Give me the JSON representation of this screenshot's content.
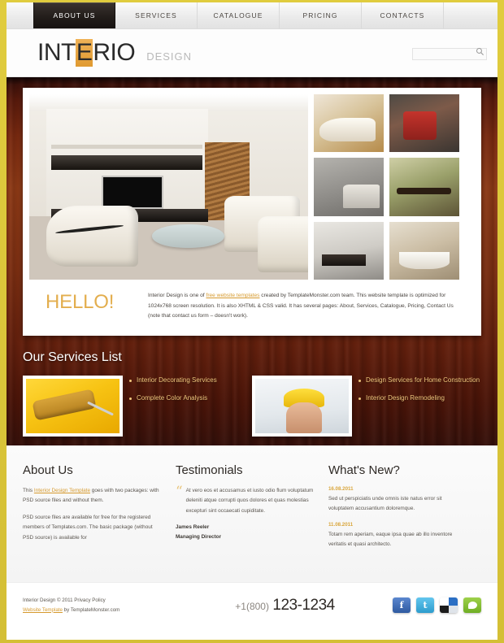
{
  "nav": {
    "items": [
      {
        "label": "ABOUT US",
        "active": true
      },
      {
        "label": "SERVICES",
        "active": false
      },
      {
        "label": "CATALOGUE",
        "active": false
      },
      {
        "label": "PRICING",
        "active": false
      },
      {
        "label": "CONTACTS",
        "active": false
      }
    ]
  },
  "brand": {
    "part1": "INT",
    "highlight": "E",
    "part2": "RIO",
    "tagline": "DESIGN"
  },
  "search": {
    "value": "",
    "placeholder": "",
    "icon": "search-icon"
  },
  "hero": {
    "main_image_alt": "modern living room with white leather furniture",
    "thumbs": [
      {
        "alt": "white lounge chair"
      },
      {
        "alt": "red chair and table"
      },
      {
        "alt": "grey bedroom"
      },
      {
        "alt": "antique table and chairs"
      },
      {
        "alt": "dark coffee table"
      },
      {
        "alt": "bathroom with tub"
      }
    ],
    "hello": "HELLO!",
    "intro_before": "Interior Design is one of ",
    "intro_link": "free website templates",
    "intro_after": " created by TemplateMonster.com team. This website template is optimized for 1024x768 screen resolution. It is also XHTML & CSS valid. It has several pages: About, Services, Catalogue, Pricing, Contact Us (note that contact us form – doesn't work)."
  },
  "services": {
    "title": "Our Services List",
    "groups": [
      {
        "image_alt": "paint roller on yellow background",
        "items": [
          "Interior Decorating Services",
          "Complete Color Analysis"
        ]
      },
      {
        "image_alt": "smiling worker in yellow hard hat",
        "items": [
          "Design Services for Home Construction",
          "Interior Design Remodeling"
        ]
      }
    ]
  },
  "about": {
    "title": "About Us",
    "p1_before": "This ",
    "p1_link": "Interior Design Template",
    "p1_after": " goes with two packages: with PSD source files and without them.",
    "p2": "PSD source files are available for free for the registered members of Templates.com. The basic package (without PSD source) is available for"
  },
  "testimonials": {
    "title": "Testimonials",
    "quote_mark": "“",
    "quote": "At vero eos et accusamus et iusto odio flum voluptatum deleniti atque corrupti quos dolores et quas molestias excepturi sint occaecati cupiditate.",
    "author_name": "James Reeler",
    "author_role": "Managing Director"
  },
  "whats_new": {
    "title": "What's New?",
    "items": [
      {
        "date": "16.08.2011",
        "text": "Sed ut perspiciatis unde omnis iste natus error sit voluptatem accusantium doloremque."
      },
      {
        "date": "11.08.2011",
        "text": "Totam rem aperiam, eaque ipsa quae ab illo inventore veritatis et quasi architecto."
      }
    ]
  },
  "footer": {
    "copyright": "Interior Design © 2011 Privacy Policy",
    "template_link": "Website Template",
    "template_by": " by TemplateMonster.com",
    "phone_prefix": "+1(800)",
    "phone_number": "123-1234",
    "socials": [
      {
        "name": "facebook",
        "glyph": "f"
      },
      {
        "name": "twitter",
        "glyph": "t"
      },
      {
        "name": "delicious",
        "glyph": ""
      },
      {
        "name": "technorati",
        "glyph": ""
      }
    ]
  },
  "colors": {
    "page_border": "#d8c43a",
    "accent_gold": "#d69a2e",
    "wood_brown": "#7d2f12",
    "nav_active": "#211c19",
    "service_text": "#f0c87e"
  }
}
